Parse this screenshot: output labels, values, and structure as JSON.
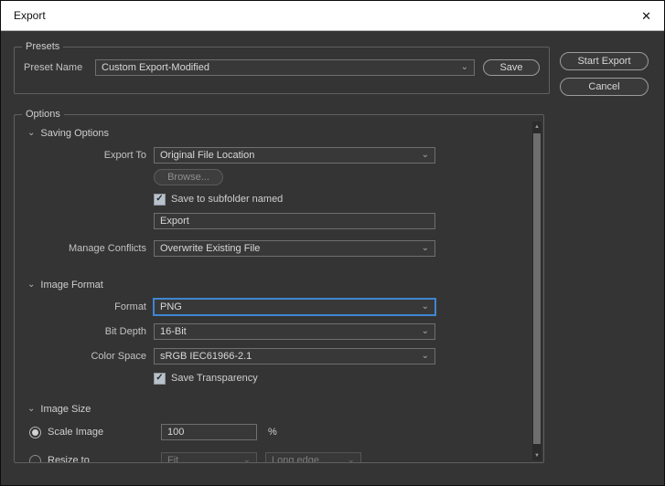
{
  "window": {
    "title": "Export"
  },
  "icons": {
    "close": "✕",
    "chevron_down": "⌄",
    "section_caret": "⌄",
    "check": "✓",
    "scroll_up": "▲",
    "scroll_down": "▼"
  },
  "colors": {
    "accent_blue": "#3f86d2"
  },
  "presets": {
    "group_label": "Presets",
    "preset_name_label": "Preset Name",
    "preset_name_value": "Custom Export-Modified",
    "save_button": "Save"
  },
  "actions": {
    "start_export": "Start Export",
    "cancel": "Cancel"
  },
  "options": {
    "group_label": "Options",
    "saving_options": {
      "section_label": "Saving Options",
      "export_to_label": "Export To",
      "export_to_value": "Original File Location",
      "browse_button": "Browse...",
      "subfolder_checkbox_label": "Save to subfolder named",
      "subfolder_checked": true,
      "subfolder_value": "Export",
      "manage_conflicts_label": "Manage Conflicts",
      "manage_conflicts_value": "Overwrite Existing File"
    },
    "image_format": {
      "section_label": "Image Format",
      "format_label": "Format",
      "format_value": "PNG",
      "bit_depth_label": "Bit Depth",
      "bit_depth_value": "16-Bit",
      "color_space_label": "Color Space",
      "color_space_value": "sRGB IEC61966-2.1",
      "transparency_checkbox_label": "Save Transparency",
      "transparency_checked": true
    },
    "image_size": {
      "section_label": "Image Size",
      "scale_image_label": "Scale Image",
      "scale_selected": true,
      "scale_value": "100",
      "percent_label": "%",
      "resize_to_label": "Resize to",
      "resize_selected": false,
      "fit_value": "Fit",
      "long_edge_value": "Long edge"
    }
  }
}
